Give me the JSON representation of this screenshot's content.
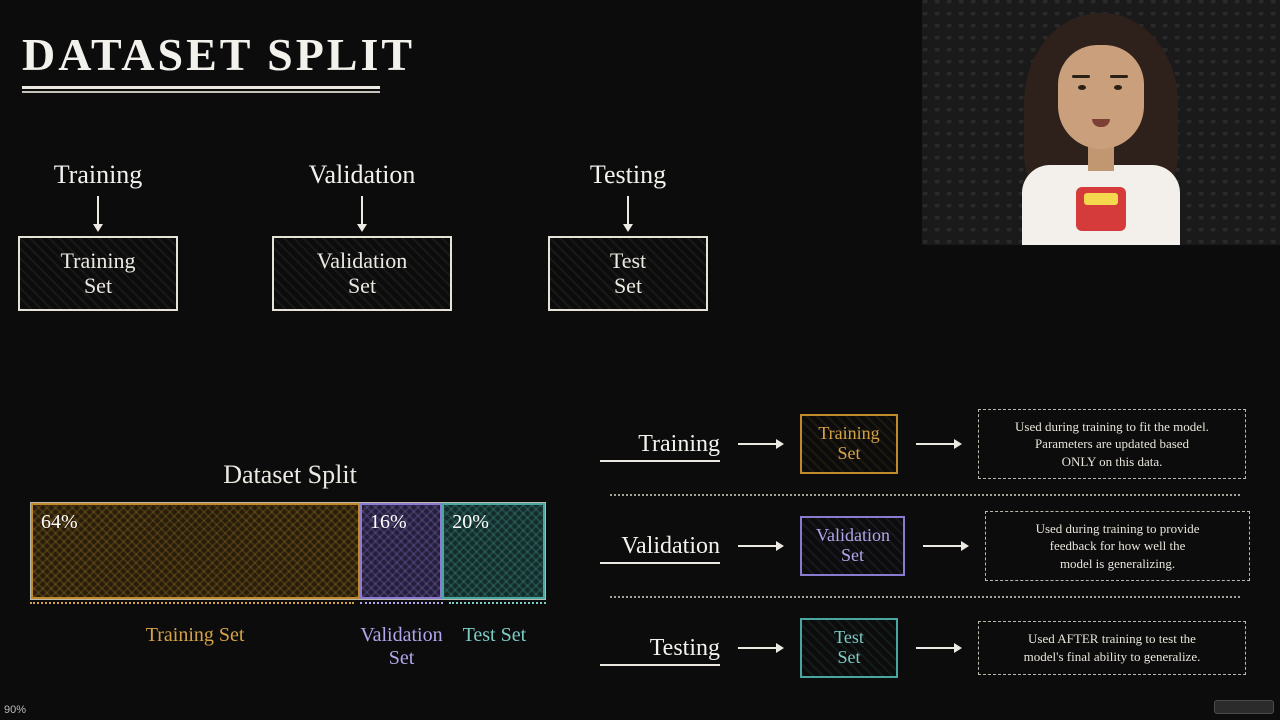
{
  "title": "DATASET SPLIT",
  "top_flows": {
    "training": {
      "label": "Training",
      "box": "Training\nSet"
    },
    "validation": {
      "label": "Validation",
      "box": "Validation\nSet"
    },
    "testing": {
      "label": "Testing",
      "box": "Test\nSet"
    }
  },
  "chart_data": {
    "type": "bar",
    "title": "Dataset Split",
    "orientation": "single-stacked-horizontal",
    "categories": [
      "Training Set",
      "Validation Set",
      "Test Set"
    ],
    "values": [
      64,
      16,
      20
    ],
    "value_labels": [
      "64%",
      "16%",
      "20%"
    ],
    "colors": [
      "#c08a2c",
      "#8a7bd0",
      "#4aa6a0"
    ],
    "xlabel": "",
    "ylabel": "",
    "ylim": [
      0,
      100
    ]
  },
  "rows": {
    "training": {
      "label": "Training",
      "box": "Training\nSet",
      "desc": "Used during training to fit the model.\nParameters are updated based\nONLY on this data."
    },
    "validation": {
      "label": "Validation",
      "box": "Validation\nSet",
      "desc": "Used during training to provide\nfeedback for how well the\nmodel is generalizing."
    },
    "testing": {
      "label": "Testing",
      "box": "Test\nSet",
      "desc": "Used AFTER training to test the\nmodel's final ability to generalize."
    }
  },
  "footer": {
    "zoom": "90%"
  }
}
